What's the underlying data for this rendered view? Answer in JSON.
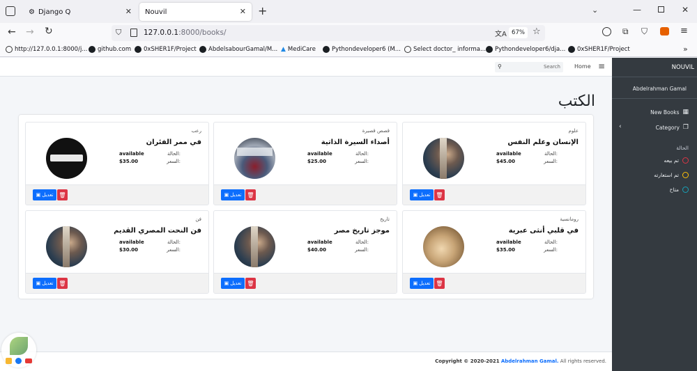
{
  "browser": {
    "tabs": [
      {
        "title": "Django Q",
        "active": false
      },
      {
        "title": "Nouvil",
        "active": true
      }
    ],
    "url_host": "127.0.0.1",
    "url_rest": ":8000/books/",
    "zoom": "67%",
    "bookmarks": [
      "http://127.0.0.1:8000/j...",
      "github.com",
      "0xSHER1F/Project",
      "AbdelsabourGamal/M...",
      "MediCare",
      "Pythondeveloper6 (M...",
      "Select doctor_ informa...",
      "Pythondeveloper6/dja...",
      "0xSHER1F/Project"
    ]
  },
  "topnav": {
    "search_placeholder": "Search",
    "home": "Home"
  },
  "page_title": "الكتب",
  "labels": {
    "status": "الحالة:",
    "price": "السعر:",
    "edit": "تعديل"
  },
  "books": [
    {
      "category": "علوم",
      "name": "الإنسان وعلم النفس",
      "status": "available",
      "price": "$45.00"
    },
    {
      "category": "قصص قصيرة",
      "name": "أصداء السيرة الذاتية",
      "status": "available",
      "price": "$25.00"
    },
    {
      "category": "رعب",
      "name": "في ممر الفئران",
      "status": "available",
      "price": "$35.00"
    },
    {
      "category": "رومانسية",
      "name": "في قلبي أنثى عبرية",
      "status": "available",
      "price": "$35.00"
    },
    {
      "category": "تاريخ",
      "name": "موجز تاريخ مصر",
      "status": "available",
      "price": "$40.00"
    },
    {
      "category": "فن",
      "name": "فن النحت المصري القديم",
      "status": "available",
      "price": "$30.00"
    }
  ],
  "sidebar": {
    "brand": "NOUVIL",
    "user": "Abdelrahman Gamal",
    "new_books": "New Books",
    "category": "Category",
    "status_heading": "الحالة",
    "statuses": [
      {
        "label": "تم بيعه",
        "color": "#dc3545"
      },
      {
        "label": "تم استعارته",
        "color": "#ffc107"
      },
      {
        "label": "متاح",
        "color": "#17a2b8"
      }
    ]
  },
  "footer": {
    "copyright": "Copyright © 2020-2021",
    "author": "Abdelrahman Gamal.",
    "rights": "All rights reserved."
  },
  "colors": {
    "sidebar_bg": "#343a40",
    "edit_button": "#0d6efd",
    "delete_button": "#dc3545",
    "author_link": "#0d6efd"
  }
}
